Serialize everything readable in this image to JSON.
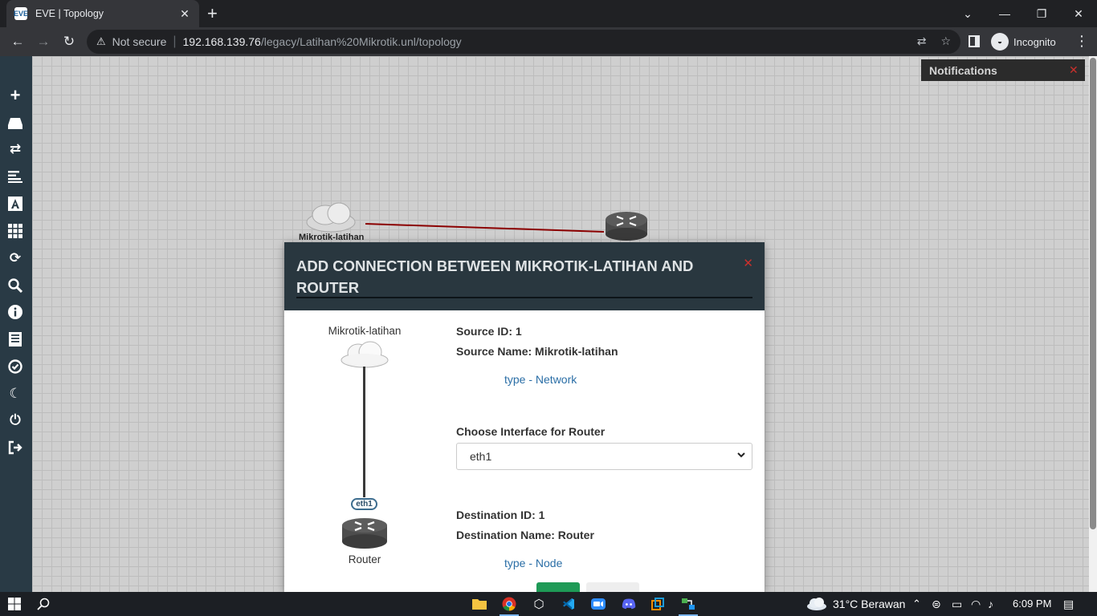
{
  "browser": {
    "tab_title": "EVE | Topology",
    "favicon_text": "EVE",
    "tab_close": "✕",
    "new_tab": "+",
    "security_label": "Not secure",
    "url_host": "192.168.139.76",
    "url_path": "/legacy/Latihan%20Mikrotik.unl/topology",
    "profile_label": "Incognito",
    "window_controls": [
      "⌄",
      "—",
      "❐",
      "✕"
    ]
  },
  "sidebar": {
    "icons": [
      "add-object-icon",
      "nodes-icon",
      "networks-icon",
      "startup-configs-icon",
      "text-icon",
      "status-icon",
      "refresh-icon",
      "zoom-icon",
      "info-icon",
      "lab-details-icon",
      "lock-icon",
      "dark-mode-icon",
      "power-icon",
      "logout-icon"
    ]
  },
  "canvas": {
    "cloud_label": "Mikrotik-latihan",
    "notifications_title": "Notifications",
    "notifications_close": "✕"
  },
  "modal": {
    "title": "ADD CONNECTION BETWEEN MIKROTIK-LATIHAN AND ROUTER",
    "close": "✕",
    "source_node_label": "Mikrotik-latihan",
    "dest_node_label": "Router",
    "interface_badge": "eth1",
    "source_id": "Source ID: 1",
    "source_name": "Source Name: Mikrotik-latihan",
    "source_type": "type - Network",
    "choose_interface_label": "Choose Interface for Router",
    "interface_selected": "eth1",
    "destination_id": "Destination ID: 1",
    "destination_name": "Destination Name: Router",
    "destination_type": "type - Node"
  },
  "taskbar": {
    "weather": "31°C  Berawan",
    "time": "6:09 PM",
    "pinned": [
      "file-explorer-icon",
      "chrome-icon",
      "virtualbox-icon",
      "vscode-icon",
      "zoom-icon",
      "discord-icon",
      "vmware-icon",
      "network-app-icon"
    ]
  },
  "colors": {
    "modal_header": "#29373f",
    "sidebar": "#293a45",
    "link": "#2a6ea6",
    "close_red": "#c9302c",
    "connection_line": "#8b0000"
  }
}
